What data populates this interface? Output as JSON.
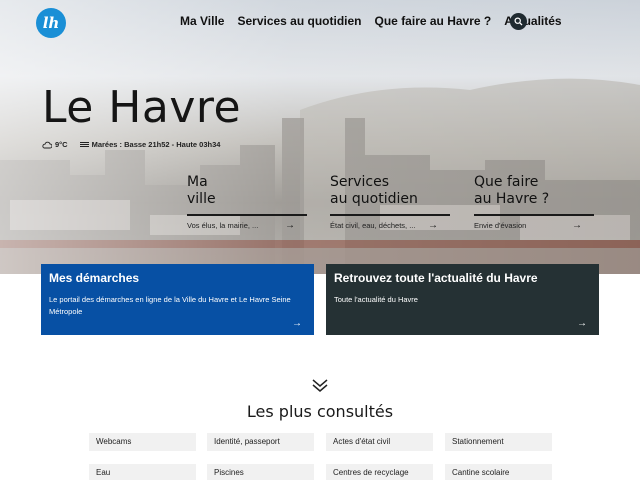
{
  "header": {
    "logo_text": "lh",
    "nav": [
      "Ma Ville",
      "Services au quotidien",
      "Que faire au Havre ?",
      "Actualités"
    ],
    "search_icon": "search-icon"
  },
  "hero": {
    "title": "Le Havre",
    "weather": "9°C",
    "tides": "Marées : Basse 21h52 - Haute 03h34",
    "cards": [
      {
        "title_l1": "Ma",
        "title_l2": "ville",
        "desc": "Vos élus, la mairie, ..."
      },
      {
        "title_l1": "Services",
        "title_l2": "au quotidien",
        "desc": "État civil, eau, déchets, ..."
      },
      {
        "title_l1": "Que faire",
        "title_l2": "au Havre ?",
        "desc": "Envie d'évasion"
      }
    ]
  },
  "bands": [
    {
      "title": "Mes démarches",
      "desc": "Le portail des démarches en ligne de la Ville du Havre et Le Havre Seine Métropole",
      "color": "#0750a4"
    },
    {
      "title": "Retrouvez toute l'actualité du Havre",
      "desc": "Toute l'actualité du Havre",
      "color": "#253134"
    }
  ],
  "consultes": {
    "title": "Les plus consultés",
    "items": [
      "Webcams",
      "Identité, passeport",
      "Actes d'état civil",
      "Stationnement",
      "Eau",
      "Piscines",
      "Centres de recyclage",
      "Cantine scolaire"
    ]
  },
  "arrow_glyph": "→"
}
